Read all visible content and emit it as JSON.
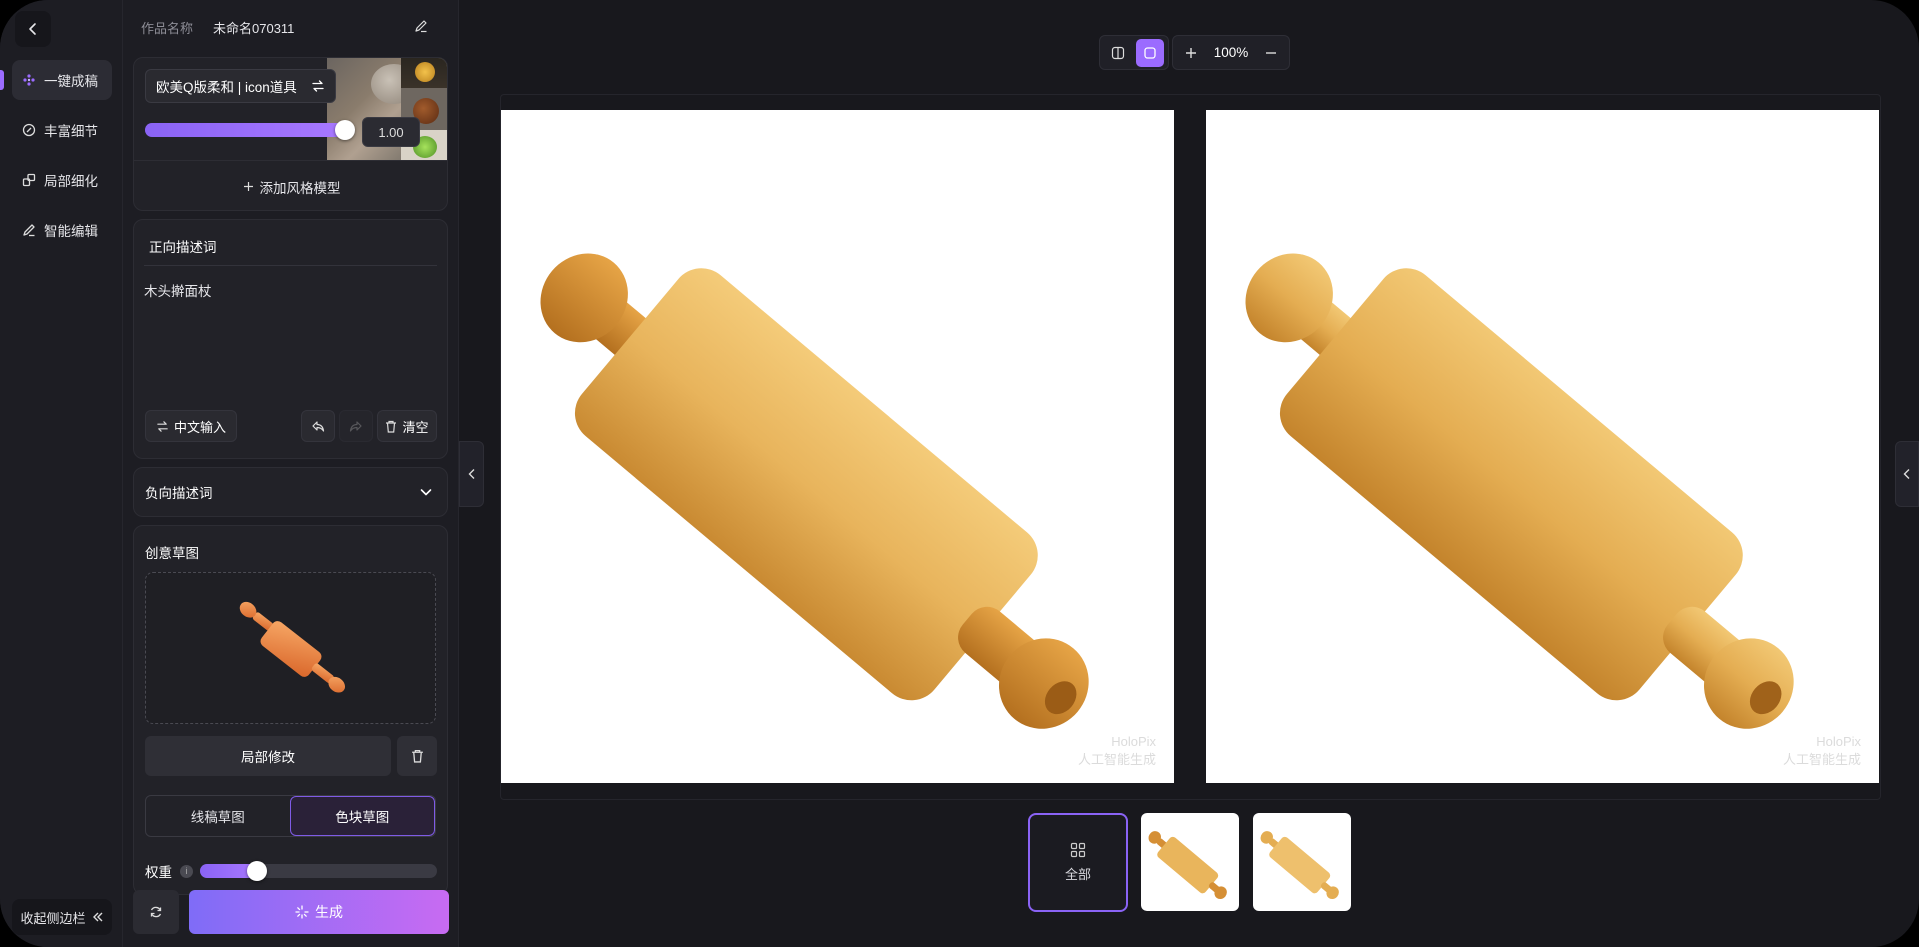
{
  "colors": {
    "accent": "#9b6bff",
    "app_bg": "#18181d",
    "panel_bg": "#1d1d23",
    "generate_gradient": [
      "#7f6cf7",
      "#c86bf2"
    ]
  },
  "nav": {
    "back_icon": "chevron-left-icon",
    "items": [
      {
        "label": "一键成稿",
        "icon": "sparkle-cluster-icon",
        "active": true
      },
      {
        "label": "丰富细节",
        "icon": "detail-icon",
        "active": false
      },
      {
        "label": "局部细化",
        "icon": "local-refine-icon",
        "active": false
      },
      {
        "label": "智能编辑",
        "icon": "pen-icon",
        "active": false
      }
    ],
    "collapse_label": "收起侧边栏"
  },
  "work": {
    "name_label": "作品名称",
    "name_value": "未命名070311"
  },
  "style_model": {
    "name": "欧美Q版柔和 | icon道具",
    "strength": "1.00",
    "strength_fraction": 1.0,
    "add_label": "添加风格模型"
  },
  "prompt": {
    "title": "正向描述词",
    "text": "木头擀面杖",
    "chinese_input_label": "中文输入",
    "clear_label": "清空"
  },
  "negative_prompt": {
    "label": "负向描述词"
  },
  "sketch": {
    "title": "创意草图",
    "local_edit_label": "局部修改",
    "modes": [
      {
        "label": "线稿草图",
        "active": false
      },
      {
        "label": "色块草图",
        "active": true
      }
    ],
    "weight_label": "权重",
    "weight_fraction": 0.24
  },
  "generate_label": "生成",
  "toolbar": {
    "zoom": "100%"
  },
  "results": {
    "watermark_line1": "HoloPix",
    "watermark_line2": "人工智能生成"
  },
  "thumbnails": {
    "all_label": "全部"
  }
}
